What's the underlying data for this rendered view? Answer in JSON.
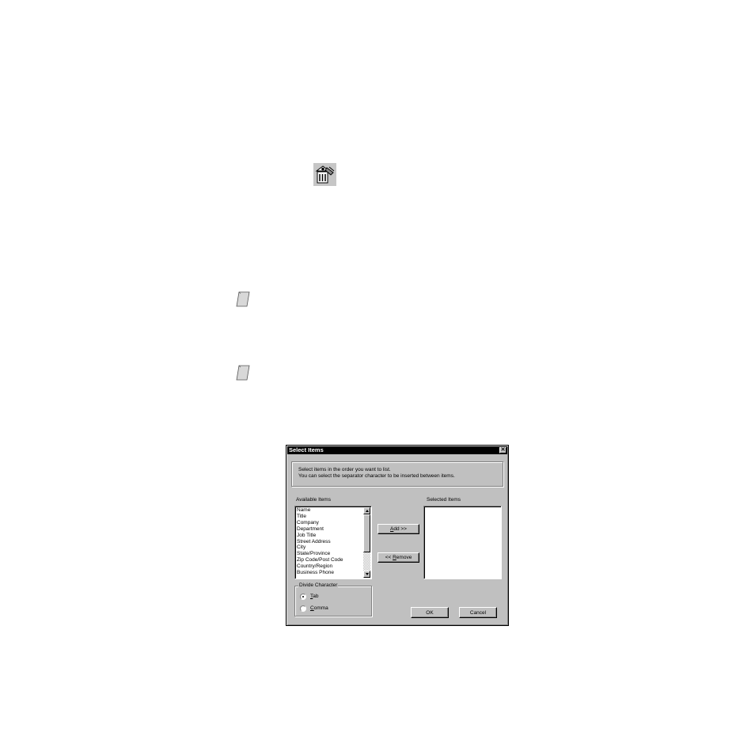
{
  "page": {
    "icons": {
      "toolbar_icon": "address-book-print-icon",
      "note_icon": "note-icon"
    }
  },
  "dialog": {
    "title": "Select Items",
    "close_label": "✕",
    "info": {
      "line1": "Select items in the order you want to list.",
      "line2": "You can select the separator character to be inserted between items."
    },
    "available": {
      "label": "Available Items",
      "items": [
        "Name",
        "Title",
        "Company",
        "Department",
        "Job Title",
        "Street Address",
        "City",
        "State/Province",
        "Zip Code/Post Code",
        "Country/Region",
        "Business Phone"
      ]
    },
    "selected": {
      "label": "Selected Items",
      "items": []
    },
    "buttons": {
      "add_mnemonic": "A",
      "add_rest": "dd >>",
      "remove_prefix": "<< ",
      "remove_mnemonic": "R",
      "remove_rest": "emove",
      "ok": "OK",
      "cancel": "Cancel"
    },
    "divide_character": {
      "legend": "Divide Character",
      "tab_mnemonic": "T",
      "tab_rest": "ab",
      "comma_mnemonic": "C",
      "comma_rest": "omma",
      "selected": "Tab"
    }
  }
}
